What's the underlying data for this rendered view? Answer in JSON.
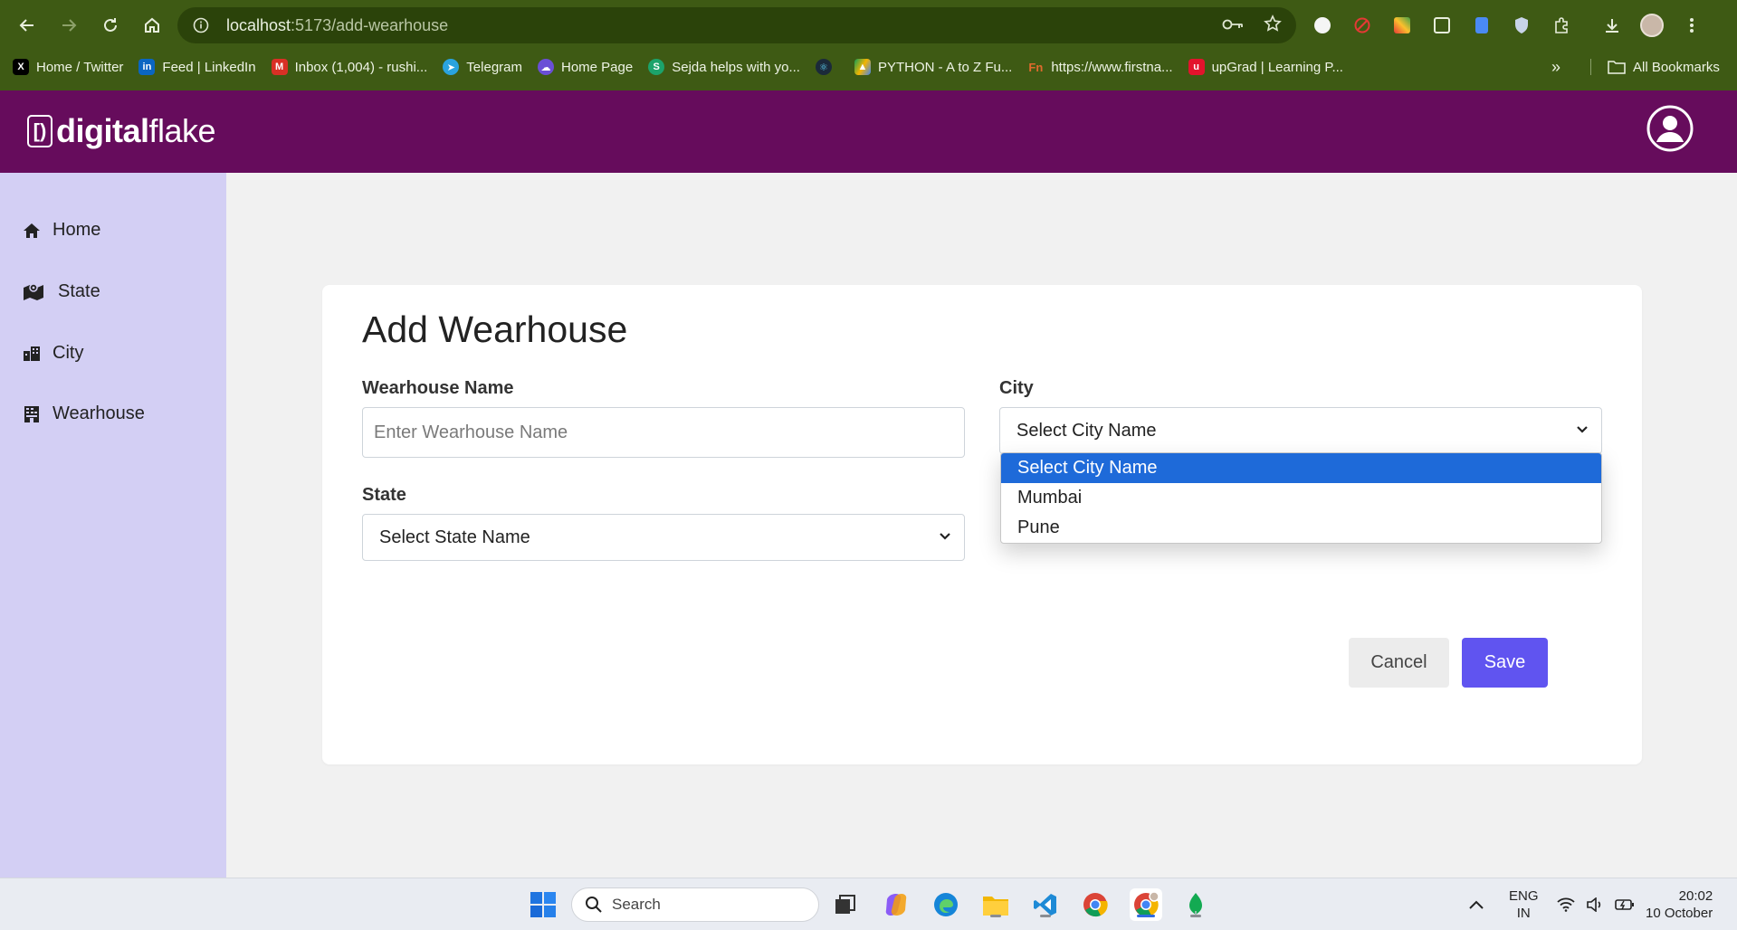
{
  "browser": {
    "url_host": "localhost",
    "url_path": ":5173/add-wearhouse",
    "bookmarks": [
      {
        "label": "Home / Twitter",
        "icon": "x-icon",
        "color": "#000000"
      },
      {
        "label": "Feed | LinkedIn",
        "icon": "linkedin-icon",
        "color": "#0a66c2"
      },
      {
        "label": "Inbox (1,004) - rushi...",
        "icon": "gmail-icon",
        "color": "#d93025"
      },
      {
        "label": "Telegram",
        "icon": "telegram-icon",
        "color": "#2aa3de"
      },
      {
        "label": "Home Page",
        "icon": "cloud-icon",
        "color": "#6a4fd6"
      },
      {
        "label": "Sejda helps with yo...",
        "icon": "sejda-icon",
        "color": "#1ca36b"
      },
      {
        "label": "",
        "icon": "react-icon",
        "color": "#1b2a3a"
      },
      {
        "label": "PYTHON - A to Z Fu...",
        "icon": "drive-icon",
        "color": "#f4b400"
      },
      {
        "label": "https://www.firstna...",
        "icon": "fn-icon",
        "color": "#b8501f"
      },
      {
        "label": "upGrad | Learning P...",
        "icon": "upgrad-icon",
        "color": "#e3132c"
      }
    ],
    "more_label": "»",
    "all_bookmarks_label": "All Bookmarks"
  },
  "app": {
    "logo_prefix": "digital",
    "logo_suffix": "flake",
    "logo_mark": "[)",
    "header_color": "#660c5c",
    "sidebar_color": "#d3cff4"
  },
  "sidebar": {
    "items": [
      {
        "label": "Home",
        "icon": "home-icon"
      },
      {
        "label": "State",
        "icon": "map-icon"
      },
      {
        "label": "City",
        "icon": "city-icon"
      },
      {
        "label": "Wearhouse",
        "icon": "warehouse-icon"
      }
    ]
  },
  "form": {
    "title": "Add Wearhouse",
    "name_label": "Wearhouse Name",
    "name_placeholder": "Enter Wearhouse Name",
    "name_value": "",
    "state_label": "State",
    "state_selected": "Select State Name",
    "city_label": "City",
    "city_selected": "Select City Name",
    "city_options": [
      "Select City Name",
      "Mumbai",
      "Pune"
    ],
    "cancel_label": "Cancel",
    "save_label": "Save",
    "accent_color": "#6054f0"
  },
  "taskbar": {
    "search_placeholder": "Search",
    "lang_top": "ENG",
    "lang_bottom": "IN",
    "time": "20:02",
    "date": "10 October"
  }
}
